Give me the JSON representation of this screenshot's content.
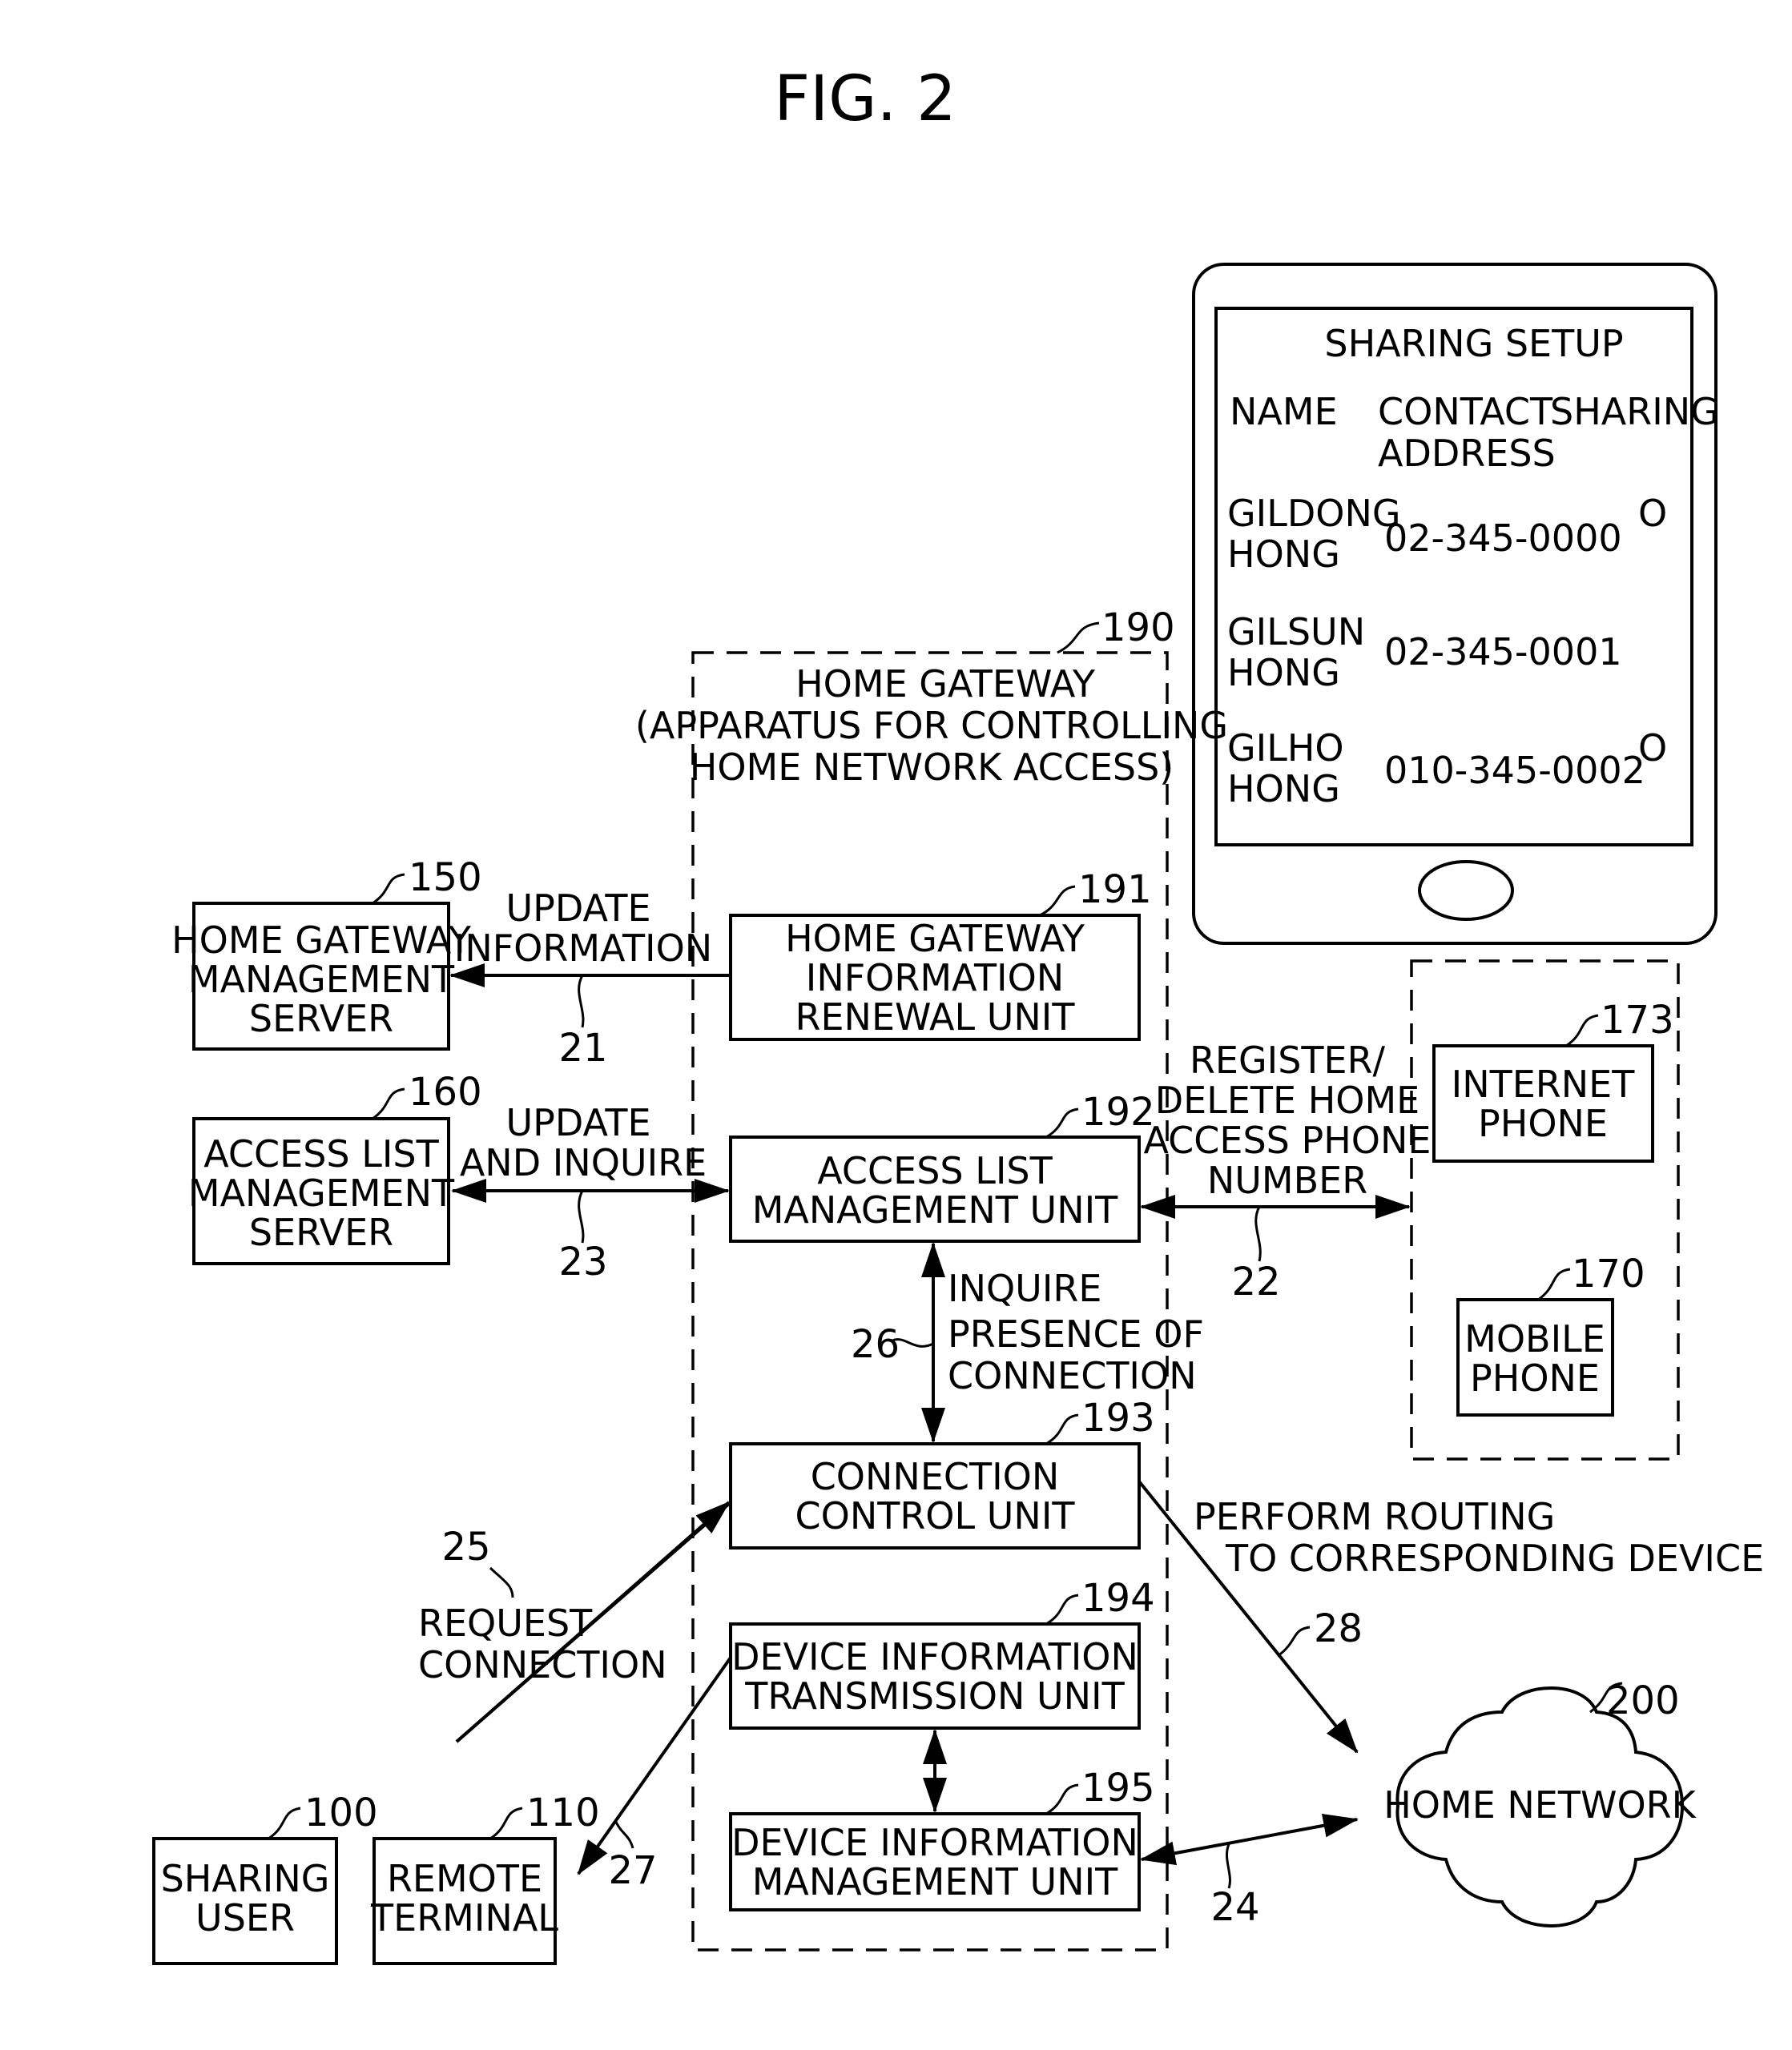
{
  "figure": {
    "title": "FIG. 2"
  },
  "home_gateway": {
    "ref": "190",
    "title_lines": [
      "HOME GATEWAY",
      "(APPARATUS FOR CONTROLLING",
      "HOME NETWORK ACCESS)"
    ],
    "units": [
      {
        "ref": "191",
        "lines": [
          "HOME GATEWAY",
          "INFORMATION",
          "RENEWAL UNIT"
        ]
      },
      {
        "ref": "192",
        "lines": [
          "ACCESS LIST",
          "MANAGEMENT UNIT"
        ]
      },
      {
        "ref": "193",
        "lines": [
          "CONNECTION",
          "CONTROL UNIT"
        ]
      },
      {
        "ref": "194",
        "lines": [
          "DEVICE INFORMATION",
          "TRANSMISSION UNIT"
        ]
      },
      {
        "ref": "195",
        "lines": [
          "DEVICE INFORMATION",
          "MANAGEMENT UNIT"
        ]
      }
    ]
  },
  "servers": [
    {
      "ref": "150",
      "lines": [
        "HOME GATEWAY",
        "MANAGEMENT",
        "SERVER"
      ]
    },
    {
      "ref": "160",
      "lines": [
        "ACCESS LIST",
        "MANAGEMENT",
        "SERVER"
      ]
    }
  ],
  "phones": [
    {
      "ref": "173",
      "lines": [
        "INTERNET",
        "PHONE"
      ]
    },
    {
      "ref": "170",
      "lines": [
        "MOBILE",
        "PHONE"
      ]
    }
  ],
  "terminals": [
    {
      "ref": "100",
      "lines": [
        "SHARING",
        "USER"
      ]
    },
    {
      "ref": "110",
      "lines": [
        "REMOTE",
        "TERMINAL"
      ]
    }
  ],
  "home_network": {
    "ref": "200",
    "label": "HOME NETWORK"
  },
  "sharing_setup": {
    "title": "SHARING SETUP",
    "headers": {
      "name": "NAME",
      "contact_lines": [
        "CONTACT",
        "ADDRESS"
      ],
      "sharing": "SHARING"
    },
    "rows": [
      {
        "name_lines": [
          "GILDONG",
          "HONG"
        ],
        "contact": "02-345-0000",
        "sharing": "O"
      },
      {
        "name_lines": [
          "GILSUN",
          "HONG"
        ],
        "contact": "02-345-0001",
        "sharing": ""
      },
      {
        "name_lines": [
          "GILHO",
          "HONG"
        ],
        "contact": "010-345-0002",
        "sharing": "O"
      }
    ]
  },
  "flows": {
    "f21": {
      "ref": "21",
      "lines": [
        "UPDATE",
        "INFORMATION"
      ]
    },
    "f23": {
      "ref": "23",
      "lines": [
        "UPDATE",
        "AND INQUIRE"
      ]
    },
    "f22": {
      "ref": "22",
      "lines": [
        "REGISTER/",
        "DELETE HOME",
        "ACCESS PHONE",
        "NUMBER"
      ]
    },
    "f26": {
      "ref": "26",
      "lines": [
        "INQUIRE",
        "PRESENCE OF",
        "CONNECTION"
      ]
    },
    "f25": {
      "ref": "25",
      "lines": [
        "REQUEST",
        "CONNECTION"
      ]
    },
    "f27": {
      "ref": "27"
    },
    "f28": {
      "ref": "28",
      "lines": [
        "PERFORM ROUTING",
        "TO CORRESPONDING DEVICE"
      ]
    },
    "f24": {
      "ref": "24"
    }
  }
}
